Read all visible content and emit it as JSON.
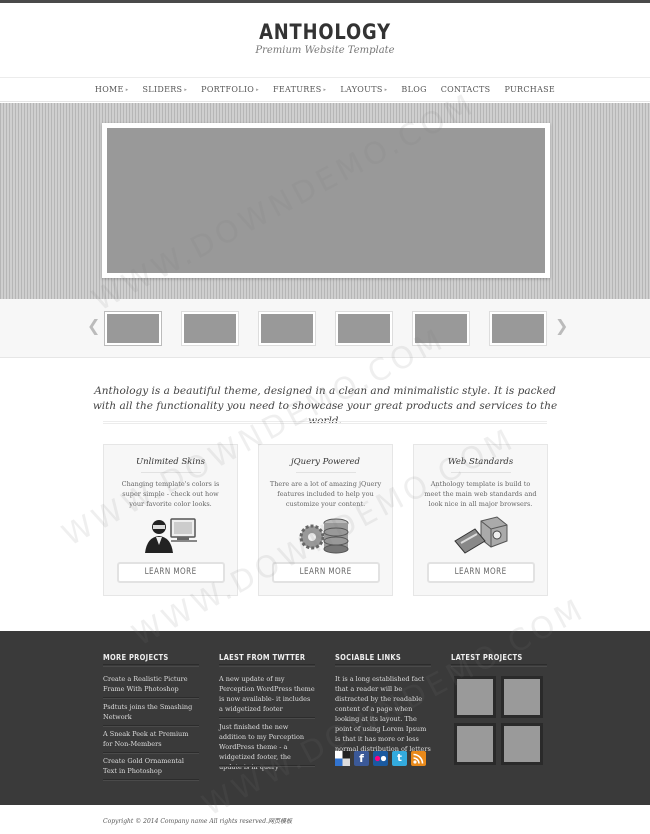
{
  "header": {
    "title": "ANTHOLOGY",
    "tagline": "Premium Website Template"
  },
  "nav": {
    "items": [
      {
        "label": "HOME",
        "has_submenu": true
      },
      {
        "label": "SLIDERS",
        "has_submenu": true
      },
      {
        "label": "PORTFOLIO",
        "has_submenu": true
      },
      {
        "label": "FEATURES",
        "has_submenu": true
      },
      {
        "label": "LAYOUTS",
        "has_submenu": true
      },
      {
        "label": "BLOG",
        "has_submenu": false
      },
      {
        "label": "CONTACTS",
        "has_submenu": false
      },
      {
        "label": "PURCHASE",
        "has_submenu": false
      }
    ],
    "submenu_glyph": "▸"
  },
  "slider": {
    "prev_glyph": "❮",
    "next_glyph": "❯",
    "thumb_count": 6
  },
  "intro": {
    "text": "Anthology is a beautiful theme, designed in a clean and minimalistic style. It is packed with all the functionality you need to showcase your great products and services to the world."
  },
  "features": [
    {
      "title": "Unlimited Skins",
      "text": "Changing template's colors is super simple - check out how your favorite color looks.",
      "icon": "user-computer-icon",
      "button": "LEARN MORE"
    },
    {
      "title": "jQuery Powered",
      "text": "There are a lot of amazing jQuery features included to help you customize your content.",
      "icon": "gears-database-icon",
      "button": "LEARN MORE"
    },
    {
      "title": "Web Standards",
      "text": "Anthology template is build to meet the main web standards and look nice in all major browsers.",
      "icon": "tools-box-icon",
      "button": "LEARN MORE"
    }
  ],
  "footer": {
    "more_projects": {
      "title": "MORE PROJECTS",
      "links": [
        "Create a Realistic Picture Frame With Photoshop",
        "Psdtuts joins the Smashing Network",
        "A Sneak Peek at Premium for Non-Members",
        "Create Gold Ornamental Text in Photoshop"
      ]
    },
    "twitter": {
      "title": "LAEST FROM TWTTER",
      "tweets": [
        "A new update of my Perception WordPress theme is now available- it includes a widgetized footer",
        "Just finished the new addition to my Perception WordPress theme - a widgetized footer, the update is in query"
      ]
    },
    "social": {
      "title": "SOCIABLE LINKS",
      "text": "It is a long established fact that a reader will be distracted by the readable content of a page when looking at its layout. The point of using Lorem Ipsum is that it has more or less normal distribution of letters",
      "icons": [
        {
          "name": "delicious-icon",
          "color": "#3274d0"
        },
        {
          "name": "facebook-icon",
          "color": "#3b5998",
          "glyph": "f"
        },
        {
          "name": "flickr-icon",
          "color": "#1a5aa0"
        },
        {
          "name": "twitter-icon",
          "color": "#33aadd",
          "glyph": "t"
        },
        {
          "name": "rss-icon",
          "color": "#e8891a"
        }
      ]
    },
    "latest_projects": {
      "title": "LATEST PROJECTS"
    }
  },
  "copyright": "Copyright © 2014 Company name All rights reserved.网页模板",
  "watermark": "WWW.DOWNDEMO.COM"
}
